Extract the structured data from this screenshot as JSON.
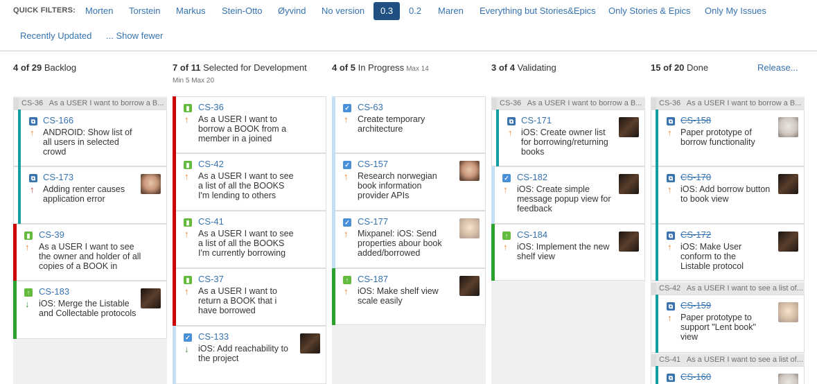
{
  "quick_filters": {
    "label": "QUICK FILTERS:",
    "items": [
      "Morten",
      "Torstein",
      "Markus",
      "Stein-Otto",
      "Øyvind",
      "No version",
      "0.3",
      "0.2",
      "Maren",
      "Everything but Stories&Epics",
      "Only Stories & Epics",
      "Only My Issues"
    ],
    "active": "0.3",
    "recently_updated": "Recently Updated",
    "show_fewer": "... Show fewer"
  },
  "columns": [
    {
      "count": "4 of 29",
      "name": "Backlog"
    },
    {
      "count": "7 of 11",
      "name": "Selected for Development",
      "sub": "Min 5  Max 20"
    },
    {
      "count": "4 of 5",
      "name": "In Progress",
      "max": "Max 14"
    },
    {
      "count": "3 of 4",
      "name": "Validating"
    },
    {
      "count": "15 of 20",
      "name": "Done",
      "release": "Release..."
    }
  ],
  "swimlanes": [
    {
      "key": "CS-36",
      "text": "As a USER I want to borrow a B..."
    },
    {
      "key": "CS-36",
      "text": "As a USER I want to borrow a B..."
    },
    {
      "key": "CS-36",
      "text": "As a USER I want to borrow a B..."
    },
    {
      "key": "CS-42",
      "text": "As a USER I want to see a list of..."
    },
    {
      "key": "CS-41",
      "text": "As a USER I want to see a list of..."
    }
  ],
  "cards": {
    "c1": {
      "key": "CS-166",
      "summary": "ANDROID: Show list of all users in selected crowd"
    },
    "c2": {
      "key": "CS-173",
      "summary": "Adding renter causes application error"
    },
    "c3": {
      "key": "CS-39",
      "summary": "As a USER I want to see the owner and holder of all copies of a BOOK in"
    },
    "c4": {
      "key": "CS-183",
      "summary": "iOS: Merge the Listable and Collectable protocols"
    },
    "c5": {
      "key": "CS-36",
      "summary": "As a USER I want to borrow a BOOK from a member in a joined"
    },
    "c6": {
      "key": "CS-42",
      "summary": "As a USER I want to see a list of all the BOOKS I'm lending to others"
    },
    "c7": {
      "key": "CS-41",
      "summary": "As a USER I want to see a list of all the BOOKS I'm currently borrowing"
    },
    "c8": {
      "key": "CS-37",
      "summary": "As a USER I want to return a BOOK that i have borrowed"
    },
    "c9": {
      "key": "CS-133",
      "summary": "iOS: Add reachability to the project"
    },
    "c10": {
      "key": "CS-63",
      "summary": "Create temporary architecture"
    },
    "c11": {
      "key": "CS-157",
      "summary": "Research norwegian book information provider APIs"
    },
    "c12": {
      "key": "CS-177",
      "summary": "Mixpanel: iOS: Send properties abour book added/borrowed"
    },
    "c13": {
      "key": "CS-187",
      "summary": "iOS: Make shelf view scale easily"
    },
    "c14": {
      "key": "CS-171",
      "summary": "iOS: Create owner list for borrowing/returning books"
    },
    "c15": {
      "key": "CS-182",
      "summary": "iOS: Create simple message popup view for feedback"
    },
    "c16": {
      "key": "CS-184",
      "summary": "iOS: Implement the new shelf view"
    },
    "c17": {
      "key": "CS-158",
      "summary": "Paper prototype of borrow functionality"
    },
    "c18": {
      "key": "CS-170",
      "summary": "iOS: Add borrow button to book view"
    },
    "c19": {
      "key": "CS-172",
      "summary": "iOS: Make User conform to the Listable protocol"
    },
    "c20": {
      "key": "CS-159",
      "summary": "Paper prototype to support \"Lent book\" view"
    },
    "c21": {
      "key": "CS-160",
      "summary": ""
    }
  },
  "colors": {
    "accent": "#3572b0",
    "active_filter": "#205081",
    "teal": "#14a0a0",
    "red": "#cc0000",
    "green": "#2ca02c",
    "light_blue": "#c5e0f5"
  }
}
